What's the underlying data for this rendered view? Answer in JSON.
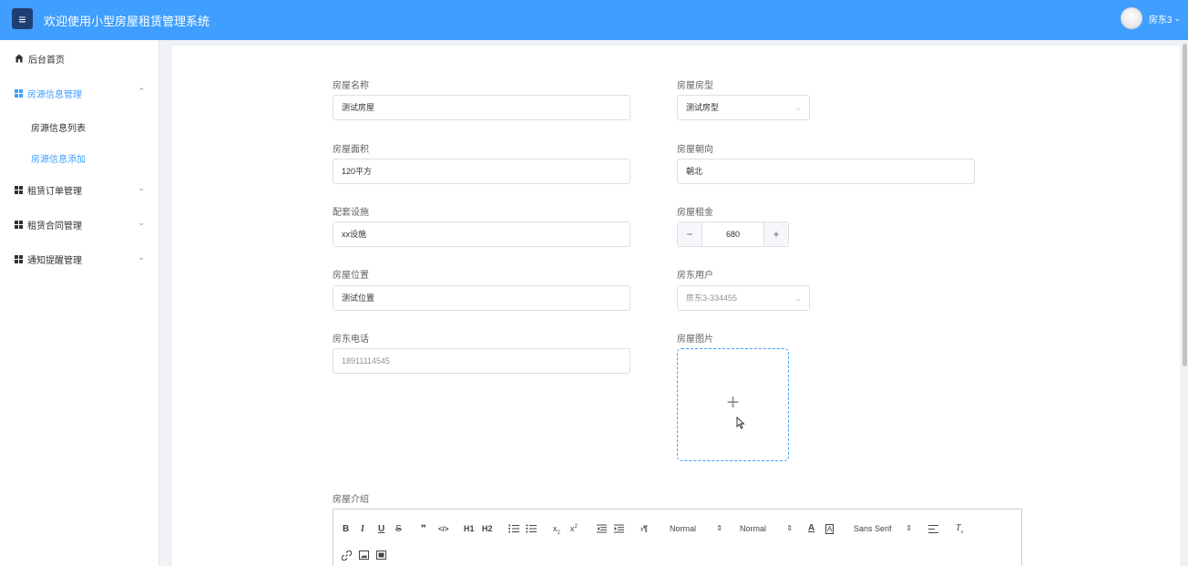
{
  "header": {
    "menu_icon": "menu-icon",
    "title": "欢迎使用小型房屋租赁管理系统",
    "user_name": "房东3",
    "caret_icon": "chevron-down-icon"
  },
  "sidebar": {
    "items": [
      {
        "label": "后台首页",
        "icon": "home-icon"
      },
      {
        "label": "房源信息管理",
        "icon": "grid-icon",
        "expanded": true
      },
      {
        "label": "房源信息列表"
      },
      {
        "label": "房源信息添加",
        "active": true
      },
      {
        "label": "租赁订单管理",
        "icon": "grid-icon"
      },
      {
        "label": "租赁合同管理",
        "icon": "grid-icon"
      },
      {
        "label": "通知提醒管理",
        "icon": "grid-icon"
      }
    ]
  },
  "form": {
    "name_label": "房屋名称",
    "name_value": "测试房屋",
    "type_label": "房屋房型",
    "type_value": "测试房型",
    "area_label": "房屋面积",
    "area_value": "120平方",
    "orient_label": "房屋朝向",
    "orient_value": "朝北",
    "facility_label": "配套设施",
    "facility_value": "xx设施",
    "rent_label": "房屋租金",
    "rent_value": "680",
    "location_label": "房屋位置",
    "location_value": "测试位置",
    "landlord_label": "房东用户",
    "landlord_value": "房东3-334455",
    "phone_label": "房东电话",
    "phone_value": "18911114545",
    "image_label": "房屋图片",
    "intro_label": "房屋介绍"
  },
  "editor_toolbar": {
    "header_select": "Normal",
    "size_select": "Normal",
    "font_select": "Sans Serif",
    "bold": "B",
    "italic": "I",
    "underline": "U",
    "strike": "S",
    "quote": "❞",
    "code": "</>",
    "h1": "H1",
    "h2": "H2",
    "pilcrow": "¶"
  }
}
